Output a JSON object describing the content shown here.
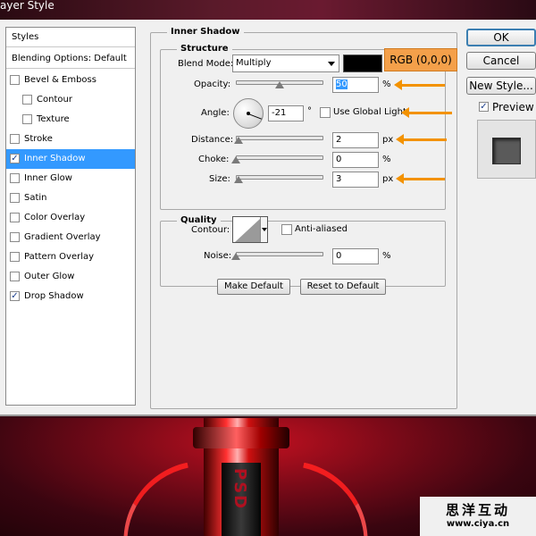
{
  "window": {
    "title": "ayer Style"
  },
  "styles_list": {
    "header": "Styles",
    "blending": "Blending Options: Default",
    "items": [
      {
        "label": "Bevel & Emboss",
        "checked": false,
        "indent": false
      },
      {
        "label": "Contour",
        "checked": false,
        "indent": true
      },
      {
        "label": "Texture",
        "checked": false,
        "indent": true
      },
      {
        "label": "Stroke",
        "checked": false,
        "indent": false
      },
      {
        "label": "Inner Shadow",
        "checked": true,
        "indent": false,
        "selected": true
      },
      {
        "label": "Inner Glow",
        "checked": false,
        "indent": false
      },
      {
        "label": "Satin",
        "checked": false,
        "indent": false
      },
      {
        "label": "Color Overlay",
        "checked": false,
        "indent": false
      },
      {
        "label": "Gradient Overlay",
        "checked": false,
        "indent": false
      },
      {
        "label": "Pattern Overlay",
        "checked": false,
        "indent": false
      },
      {
        "label": "Outer Glow",
        "checked": false,
        "indent": false
      },
      {
        "label": "Drop Shadow",
        "checked": true,
        "indent": false
      }
    ]
  },
  "inner_shadow": {
    "title": "Inner Shadow",
    "structure": {
      "title": "Structure",
      "blend_mode_label": "Blend Mode:",
      "blend_mode_value": "Multiply",
      "color": "#000000",
      "color_note": "RGB (0,0,0)",
      "opacity_label": "Opacity:",
      "opacity_value": "50",
      "opacity_unit": "%",
      "opacity_level": 0.5,
      "angle_label": "Angle:",
      "angle_value": "-21",
      "angle_unit": "°",
      "global_light_label": "Use Global Light",
      "global_light_checked": false,
      "distance_label": "Distance:",
      "distance_value": "2",
      "distance_unit": "px",
      "choke_label": "Choke:",
      "choke_value": "0",
      "choke_unit": "%",
      "size_label": "Size:",
      "size_value": "3",
      "size_unit": "px"
    },
    "quality": {
      "title": "Quality",
      "contour_label": "Contour:",
      "anti_aliased_label": "Anti-aliased",
      "anti_aliased_checked": false,
      "noise_label": "Noise:",
      "noise_value": "0",
      "noise_unit": "%"
    },
    "make_default_label": "Make Default",
    "reset_default_label": "Reset to Default"
  },
  "side": {
    "ok_label": "OK",
    "cancel_label": "Cancel",
    "new_style_label": "New Style...",
    "preview_label": "Preview",
    "preview_checked": true
  },
  "artwork": {
    "can_text": "PSD"
  },
  "watermark": {
    "line1": "思洋互动",
    "line2": "www.ciya.cn"
  },
  "colors": {
    "accent_arrow": "#f39200",
    "selection": "#3399ff",
    "callout": "#f4a04a"
  },
  "icons": {
    "check": "check-mark",
    "dial": "angle-dial-icon",
    "dropdown": "chevron-down-icon"
  }
}
